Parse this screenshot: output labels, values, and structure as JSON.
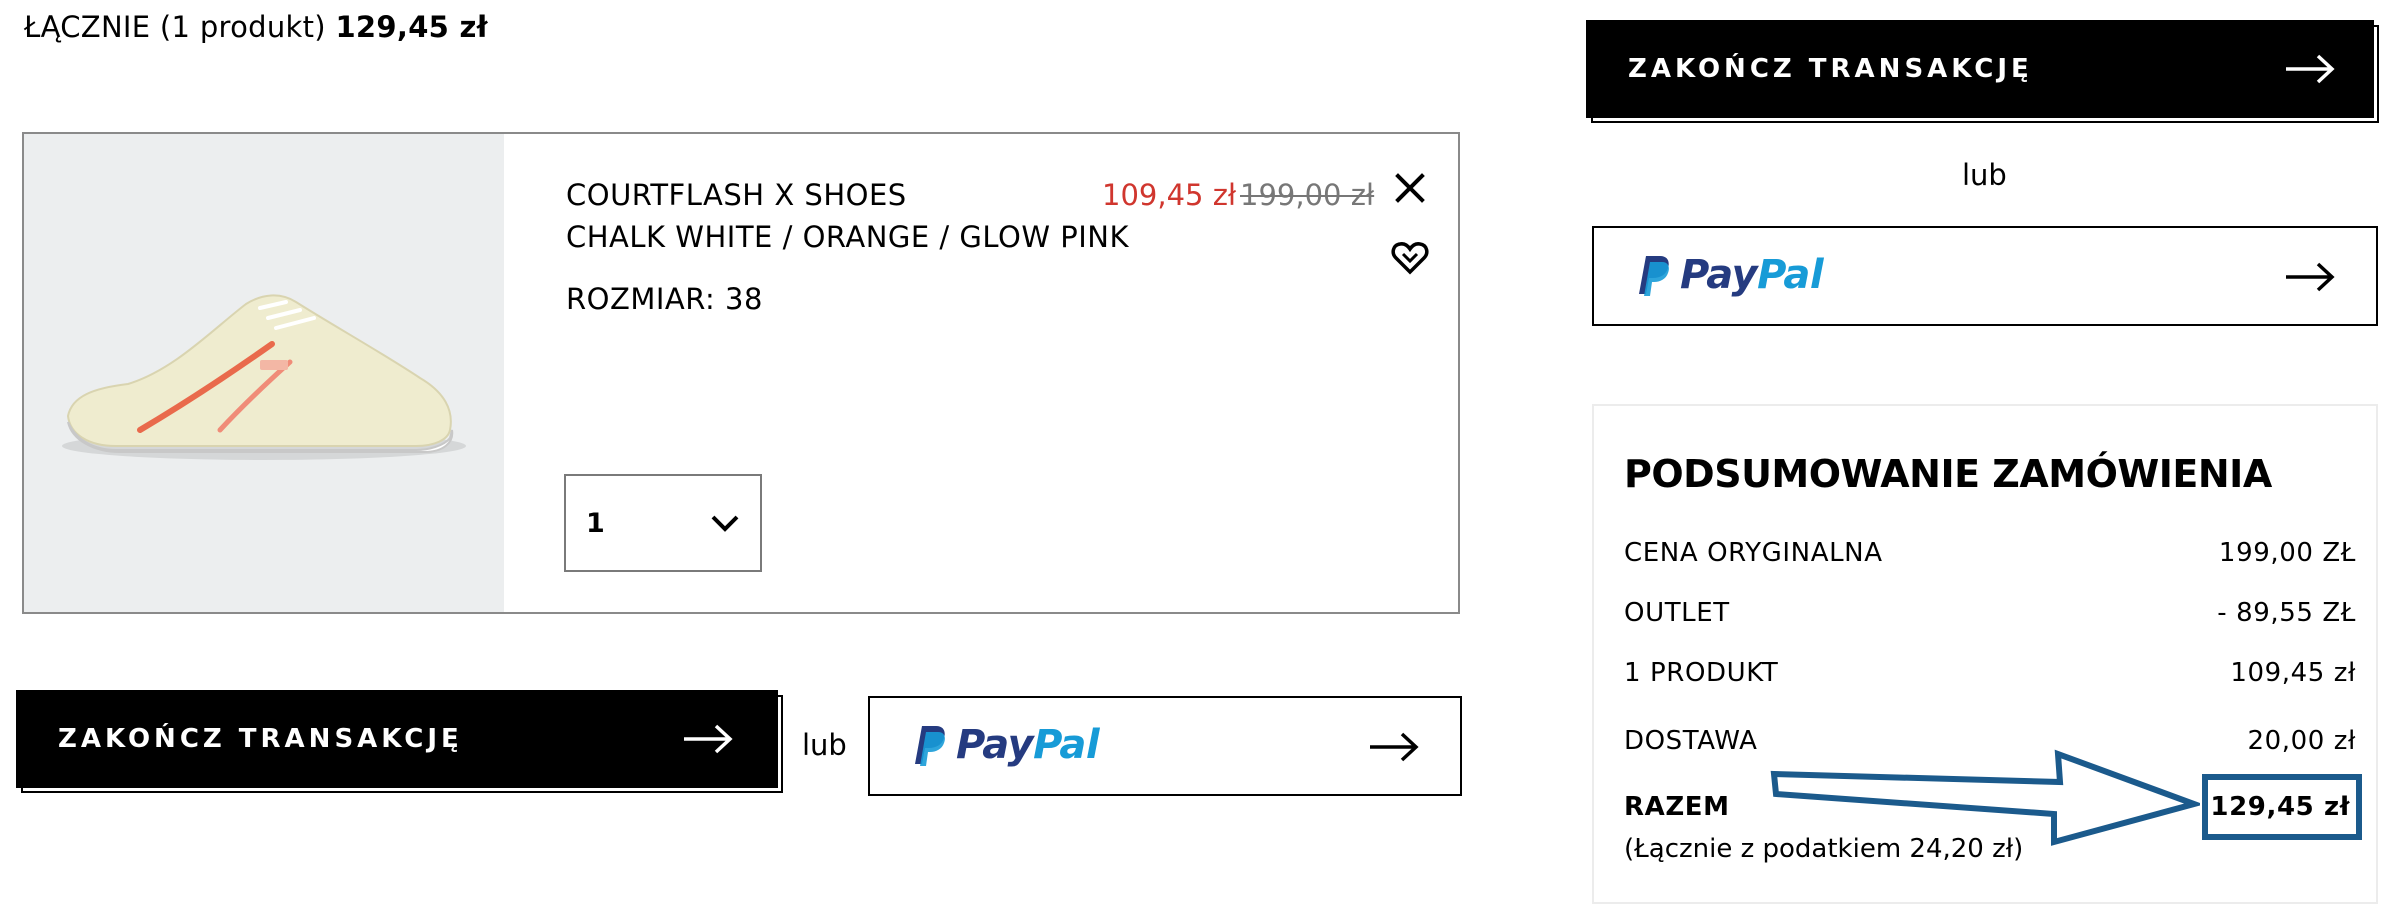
{
  "cart_summary": {
    "label": "ŁĄCZNIE (1 produkt)",
    "total": "129,45 zł"
  },
  "product": {
    "name": "COURTFLASH X SHOES",
    "color": "CHALK WHITE / ORANGE / GLOW PINK",
    "size_label": "ROZMIAR: 38",
    "sale_price": "109,45 zł",
    "original_price": "199,00 zł",
    "quantity": "1"
  },
  "checkout": {
    "button_label": "ZAKOŃCZ TRANSAKCJĘ",
    "or_label": "lub",
    "paypal_pay": "Pay",
    "paypal_pal": "Pal"
  },
  "order_summary": {
    "title": "PODSUMOWANIE ZAMÓWIENIA",
    "rows": [
      {
        "label": "CENA ORYGINALNA",
        "value": "199,00 ZŁ"
      },
      {
        "label": "OUTLET",
        "value": "- 89,55 ZŁ"
      },
      {
        "label": "1 PRODUKT",
        "value": "109,45 zł"
      },
      {
        "label": "DOSTAWA",
        "value": "20,00 zł"
      },
      {
        "label": "RAZEM",
        "value": "129,45 zł"
      }
    ],
    "tax_note": "(Łącznie z podatkiem  24,20 zł)"
  },
  "colors": {
    "sale_red": "#d0362e",
    "paypal_dark": "#253b80",
    "paypal_light": "#179bd7",
    "annotation_blue": "#1b5a8c"
  },
  "icons": [
    "close-icon",
    "heart-icon",
    "chevron-down-icon",
    "arrow-right-icon",
    "paypal-logo"
  ]
}
